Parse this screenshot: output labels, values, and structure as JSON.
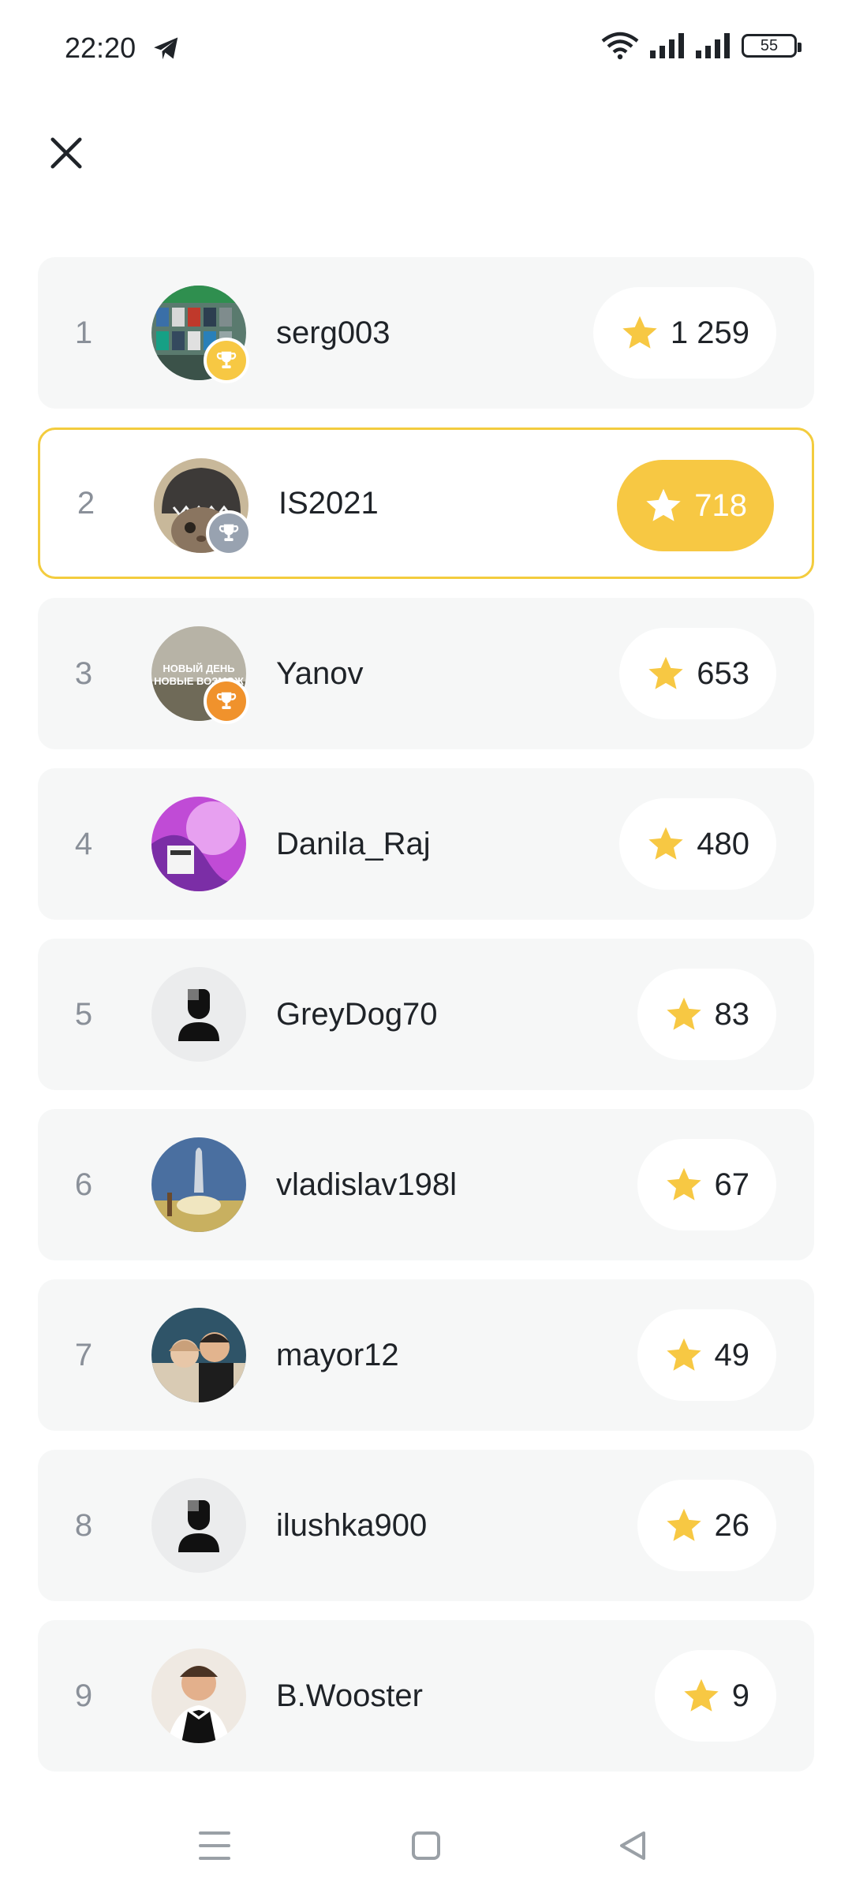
{
  "status_bar": {
    "time": "22:20",
    "battery": "55"
  },
  "leaderboard": [
    {
      "rank": "1",
      "name": "serg003",
      "score": "1 259",
      "badge": "gold",
      "avatar": "photo-shelves",
      "current": false
    },
    {
      "rank": "2",
      "name": "IS2021",
      "score": "718",
      "badge": "silver",
      "avatar": "photo-cat-hat",
      "current": true
    },
    {
      "rank": "3",
      "name": "Yanov",
      "score": "653",
      "badge": "bronze",
      "avatar": "photo-sky-text",
      "current": false
    },
    {
      "rank": "4",
      "name": "Danila_Raj",
      "score": "480",
      "badge": "none",
      "avatar": "photo-purple-art",
      "current": false
    },
    {
      "rank": "5",
      "name": "GreyDog70",
      "score": "83",
      "badge": "none",
      "avatar": "default-user",
      "current": false
    },
    {
      "rank": "6",
      "name": "vladislav198l",
      "score": "67",
      "badge": "none",
      "avatar": "photo-rocket",
      "current": false
    },
    {
      "rank": "7",
      "name": "mayor12",
      "score": "49",
      "badge": "none",
      "avatar": "photo-couple",
      "current": false
    },
    {
      "rank": "8",
      "name": "ilushka900",
      "score": "26",
      "badge": "none",
      "avatar": "default-user",
      "current": false
    },
    {
      "rank": "9",
      "name": "B.Wooster",
      "score": "9",
      "badge": "none",
      "avatar": "photo-man-suit",
      "current": false
    }
  ],
  "colors": {
    "accent": "#f7c843",
    "gold": "#f7c843",
    "silver": "#98a2b0",
    "bronze": "#f0922c",
    "row_bg": "#f6f7f7"
  },
  "icons": {
    "close": "close-icon",
    "star": "star-icon",
    "trophy": "trophy-icon",
    "menu": "menu-icon",
    "home": "home-icon",
    "back": "back-icon"
  }
}
